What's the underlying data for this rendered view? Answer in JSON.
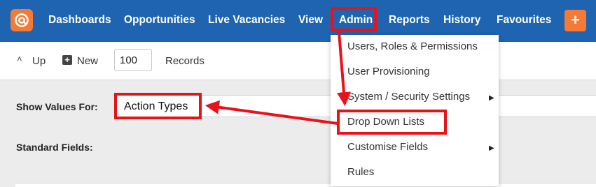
{
  "nav": {
    "items": [
      "Dashboards",
      "Opportunities",
      "Live Vacancies",
      "View",
      "Admin",
      "Reports",
      "History",
      "Favourites"
    ],
    "plus_label": "+"
  },
  "toolbar": {
    "up_label": "Up",
    "new_label": "New",
    "records_value": "100",
    "records_label": "Records"
  },
  "form": {
    "show_values_label": "Show Values For:",
    "show_values_value": "Action Types",
    "standard_fields_label": "Standard Fields:"
  },
  "admin_menu": {
    "items": [
      "Users, Roles & Permissions",
      "User Provisioning",
      "System / Security Settings",
      "Drop Down Lists",
      "Customise Fields",
      "Rules"
    ]
  },
  "colors": {
    "nav_bg": "#1f64b0",
    "accent_orange": "#f47a35",
    "annotation_red": "#e8131a"
  },
  "icons": {
    "logo": "at-sign-logo-icon",
    "up": "chevron-up-icon",
    "new": "plus-square-icon",
    "submenu": "caret-right-icon"
  }
}
